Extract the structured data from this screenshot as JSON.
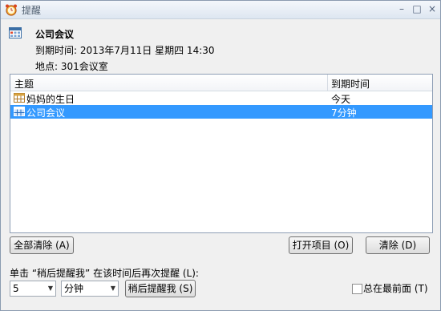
{
  "window": {
    "title": "提醒",
    "minimize": "–",
    "maximize": "□",
    "close": "×"
  },
  "header": {
    "subject": "公司会议",
    "due": "到期时间: 2013年7月11日 星期四 14:30",
    "location": "地点: 301会议室"
  },
  "table": {
    "columns": [
      "主题",
      "到期时间"
    ],
    "rows": [
      {
        "subject": "妈妈的生日",
        "due": "今天",
        "selected": false
      },
      {
        "subject": "公司会议",
        "due": "7分钟",
        "selected": true
      }
    ]
  },
  "buttons": {
    "clear_all": "全部清除 (A)",
    "open_item": "打开项目 (O)",
    "clear": "清除 (D)",
    "snooze": "稍后提醒我 (S)"
  },
  "snooze": {
    "label": "单击 “稍后提醒我” 在该时间后再次提醒 (L):",
    "amount": "5",
    "unit": "分钟"
  },
  "always_on_top": {
    "label": "总在最前面 (T)",
    "checked": false
  },
  "colors": {
    "selection": "#3399ff",
    "window_bg": "#f0f0f0"
  }
}
